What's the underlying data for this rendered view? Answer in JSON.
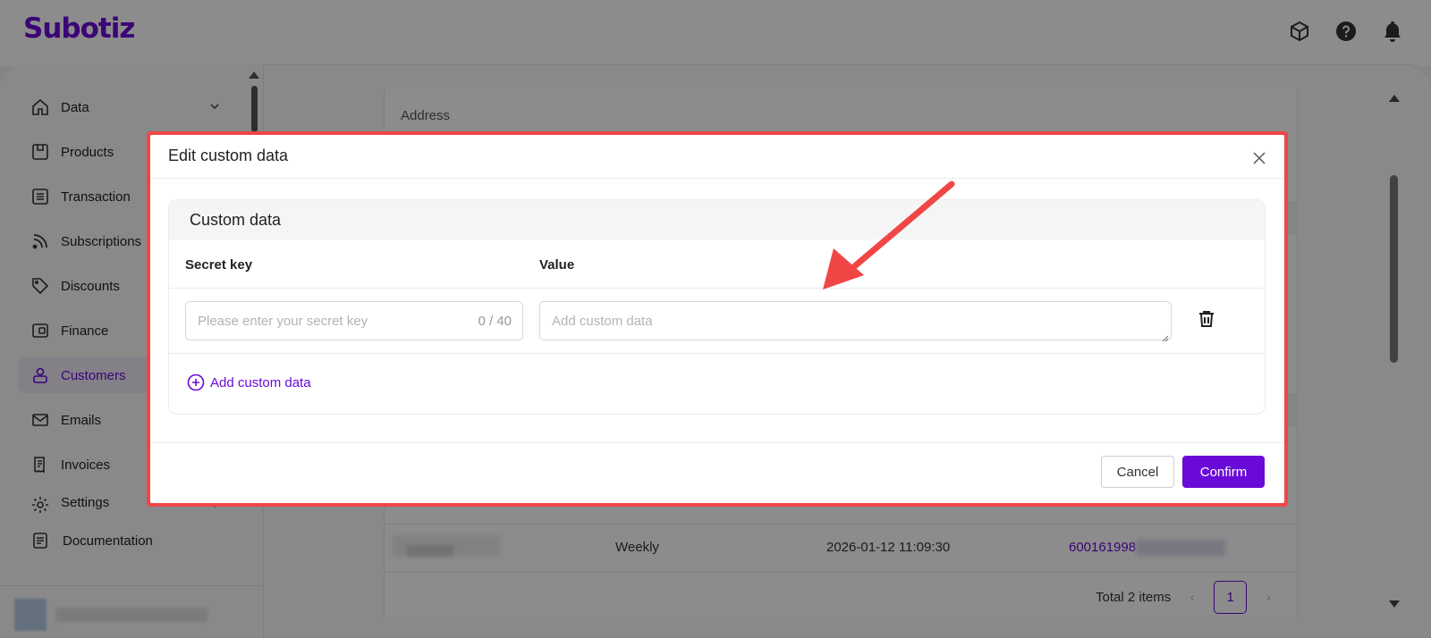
{
  "brand": {
    "logo_text": "Subotiz",
    "accent_color": "#6a0ad8",
    "highlight_color": "#f04646"
  },
  "topbar": {
    "icons": [
      "box-icon",
      "help-icon",
      "bell-icon"
    ]
  },
  "sidebar": {
    "items": [
      {
        "label": "Data",
        "icon": "home-icon",
        "has_chevron": true
      },
      {
        "label": "Products",
        "icon": "product-icon"
      },
      {
        "label": "Transaction",
        "icon": "list-icon"
      },
      {
        "label": "Subscriptions",
        "icon": "rss-icon"
      },
      {
        "label": "Discounts",
        "icon": "tag-icon"
      },
      {
        "label": "Finance",
        "icon": "wallet-icon"
      },
      {
        "label": "Customers",
        "icon": "user-icon",
        "active": true
      },
      {
        "label": "Emails",
        "icon": "mail-icon"
      },
      {
        "label": "Invoices",
        "icon": "invoice-icon"
      },
      {
        "label": "Settings",
        "icon": "gear-icon",
        "has_chevron": true
      }
    ],
    "documentation_label": "Documentation"
  },
  "background": {
    "address_label": "Address",
    "table_row": {
      "frequency": "Weekly",
      "datetime": "2026-01-12 11:09:30",
      "id_link": "600161998"
    },
    "pagination": {
      "total_text": "Total 2 items",
      "current_page": "1"
    }
  },
  "modal": {
    "title": "Edit custom data",
    "section_title": "Custom data",
    "col_secret_key": "Secret key",
    "col_value": "Value",
    "secret_key_placeholder": "Please enter your secret key",
    "secret_key_counter": "0 / 40",
    "value_placeholder": "Add custom data",
    "add_link_label": "Add custom data",
    "cancel_label": "Cancel",
    "confirm_label": "Confirm"
  }
}
